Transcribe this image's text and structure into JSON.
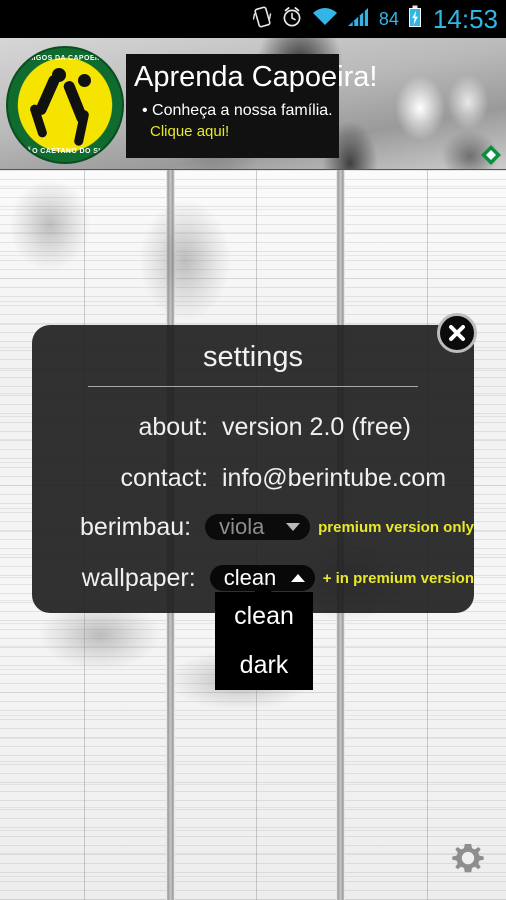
{
  "statusbar": {
    "icons": [
      "vibrate-icon",
      "alarm-clock-icon",
      "wifi-icon",
      "signal-bars-icon",
      "battery-charging-icon"
    ],
    "battery_level": "84",
    "clock": "14:53",
    "accent_color": "#33b5e5"
  },
  "ad": {
    "logo_top_text": "AMIGOS DA CAPOEIRA",
    "logo_bottom_text": "SÃO CAETANO DO SUL",
    "headline": "Aprenda Capoeira!",
    "bullet": "• Conheça a nossa família.",
    "cta": "Clique aqui!",
    "cta_color": "#e8e82a",
    "network_icon": "admob-diamond-icon"
  },
  "dialog": {
    "title": "settings",
    "close_label": "×",
    "rows": [
      {
        "label": "about:",
        "value": "version 2.0 (free)"
      },
      {
        "label": "contact:",
        "value": "info@berintube.com"
      }
    ],
    "berimbau": {
      "label": "berimbau:",
      "selected": "viola",
      "caret": "chevron-down-icon",
      "hint": "premium version only",
      "hint_color": "#e8e82a",
      "disabled": true
    },
    "wallpaper": {
      "label": "wallpaper:",
      "selected": "clean",
      "caret": "chevron-up-icon",
      "hint": "+ in premium version",
      "hint_color": "#e8e82a",
      "options": [
        "clean",
        "dark"
      ],
      "expanded": true
    }
  },
  "overlay": {
    "gear_icon": "gear-icon"
  }
}
